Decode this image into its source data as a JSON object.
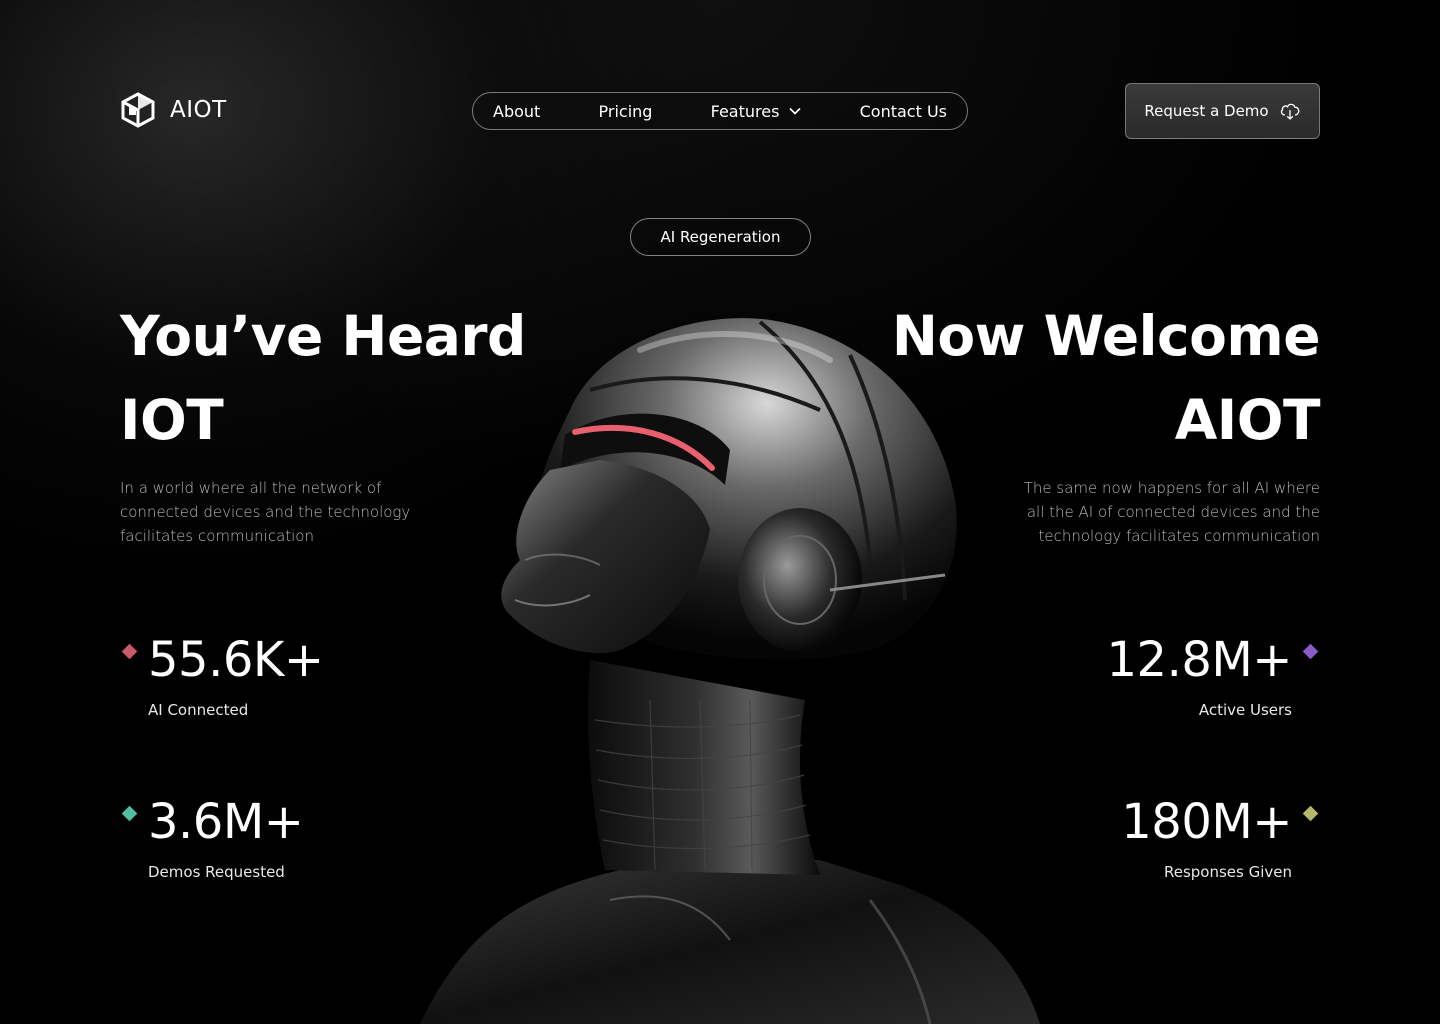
{
  "brand": {
    "name": "AIOT",
    "logo_icon": "cube-logo-icon"
  },
  "nav": {
    "items": [
      {
        "label": "About"
      },
      {
        "label": "Pricing"
      },
      {
        "label": "Features",
        "icon": "chevron-down-icon"
      },
      {
        "label": "Contact Us"
      }
    ]
  },
  "cta": {
    "label": "Request a Demo",
    "icon": "cloud-download-icon"
  },
  "badge": {
    "label": "AI Regeneration"
  },
  "hero": {
    "left_line1": "You’ve Heard",
    "left_line2": "IOT",
    "left_text": "In a world where all the network of connected devices and the technology facilitates communication",
    "right_line1": "Now Welcome",
    "right_line2": "AIOT",
    "right_text": "The same now happens for all AI where all the AI of connected devices and the technology facilitates communication"
  },
  "stats": {
    "ai_connected": {
      "value": "55.6K+",
      "label": "AI Connected",
      "color": "#c85a6a"
    },
    "demos_requested": {
      "value": "3.6M+",
      "label": "Demos Requested",
      "color": "#4fbf9f"
    },
    "active_users": {
      "value": "12.8M+",
      "label": "Active Users",
      "color": "#8a5ac8"
    },
    "responses_given": {
      "value": "180M+",
      "label": "Responses Given",
      "color": "#b5b86a"
    }
  },
  "colors": {
    "background": "#000000",
    "accent_visor": "#e8606e"
  }
}
